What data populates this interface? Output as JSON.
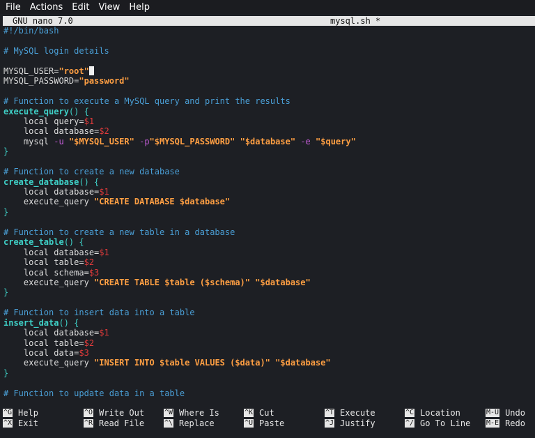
{
  "menubar": {
    "items": [
      "File",
      "Actions",
      "Edit",
      "View",
      "Help"
    ]
  },
  "titlebar": {
    "app_name": "GNU nano 7.0",
    "file_name": "mysql.sh *"
  },
  "editor": {
    "lines": [
      [
        {
          "t": "#!/bin/bash",
          "c": "comment"
        }
      ],
      [],
      [
        {
          "t": "# MySQL login details",
          "c": "comment"
        }
      ],
      [],
      [
        {
          "t": "MYSQL_USER=",
          "c": "text"
        },
        {
          "t": "\"root\"",
          "c": "string"
        },
        {
          "t": "",
          "c": "cursor"
        }
      ],
      [
        {
          "t": "MYSQL_PASSWORD=",
          "c": "text"
        },
        {
          "t": "\"password\"",
          "c": "string"
        }
      ],
      [],
      [
        {
          "t": "# Function to execute a MySQL query and print the results",
          "c": "comment"
        }
      ],
      [
        {
          "t": "execute_query",
          "c": "func"
        },
        {
          "t": "() {",
          "c": "brace"
        }
      ],
      [
        {
          "t": "    local query=",
          "c": "keyword"
        },
        {
          "t": "$1",
          "c": "var"
        }
      ],
      [
        {
          "t": "    local database=",
          "c": "keyword"
        },
        {
          "t": "$2",
          "c": "var"
        }
      ],
      [
        {
          "t": "    mysql ",
          "c": "text"
        },
        {
          "t": "-u",
          "c": "flag"
        },
        {
          "t": " ",
          "c": "text"
        },
        {
          "t": "\"$MYSQL_USER\"",
          "c": "string"
        },
        {
          "t": " ",
          "c": "text"
        },
        {
          "t": "-p",
          "c": "flag"
        },
        {
          "t": "\"$MYSQL_PASSWORD\"",
          "c": "string"
        },
        {
          "t": " ",
          "c": "text"
        },
        {
          "t": "\"$database\"",
          "c": "string"
        },
        {
          "t": " ",
          "c": "text"
        },
        {
          "t": "-e",
          "c": "flag"
        },
        {
          "t": " ",
          "c": "text"
        },
        {
          "t": "\"$query\"",
          "c": "string"
        }
      ],
      [
        {
          "t": "}",
          "c": "brace"
        }
      ],
      [],
      [
        {
          "t": "# Function to create a new database",
          "c": "comment"
        }
      ],
      [
        {
          "t": "create_database",
          "c": "func"
        },
        {
          "t": "() {",
          "c": "brace"
        }
      ],
      [
        {
          "t": "    local database=",
          "c": "keyword"
        },
        {
          "t": "$1",
          "c": "var"
        }
      ],
      [
        {
          "t": "    execute_query ",
          "c": "text"
        },
        {
          "t": "\"CREATE DATABASE $database\"",
          "c": "string"
        }
      ],
      [
        {
          "t": "}",
          "c": "brace"
        }
      ],
      [],
      [
        {
          "t": "# Function to create a new table in a database",
          "c": "comment"
        }
      ],
      [
        {
          "t": "create_table",
          "c": "func"
        },
        {
          "t": "() {",
          "c": "brace"
        }
      ],
      [
        {
          "t": "    local database=",
          "c": "keyword"
        },
        {
          "t": "$1",
          "c": "var"
        }
      ],
      [
        {
          "t": "    local table=",
          "c": "keyword"
        },
        {
          "t": "$2",
          "c": "var"
        }
      ],
      [
        {
          "t": "    local schema=",
          "c": "keyword"
        },
        {
          "t": "$3",
          "c": "var"
        }
      ],
      [
        {
          "t": "    execute_query ",
          "c": "text"
        },
        {
          "t": "\"CREATE TABLE $table ($schema)\"",
          "c": "string"
        },
        {
          "t": " ",
          "c": "text"
        },
        {
          "t": "\"$database\"",
          "c": "string"
        }
      ],
      [
        {
          "t": "}",
          "c": "brace"
        }
      ],
      [],
      [
        {
          "t": "# Function to insert data into a table",
          "c": "comment"
        }
      ],
      [
        {
          "t": "insert_data",
          "c": "func"
        },
        {
          "t": "() {",
          "c": "brace"
        }
      ],
      [
        {
          "t": "    local database=",
          "c": "keyword"
        },
        {
          "t": "$1",
          "c": "var"
        }
      ],
      [
        {
          "t": "    local table=",
          "c": "keyword"
        },
        {
          "t": "$2",
          "c": "var"
        }
      ],
      [
        {
          "t": "    local data=",
          "c": "keyword"
        },
        {
          "t": "$3",
          "c": "var"
        }
      ],
      [
        {
          "t": "    execute_query ",
          "c": "text"
        },
        {
          "t": "\"INSERT INTO $table VALUES ($data)\"",
          "c": "string"
        },
        {
          "t": " ",
          "c": "text"
        },
        {
          "t": "\"$database\"",
          "c": "string"
        }
      ],
      [
        {
          "t": "}",
          "c": "brace"
        }
      ],
      [],
      [
        {
          "t": "# Function to update data in a table",
          "c": "comment"
        }
      ]
    ]
  },
  "shortcuts": [
    {
      "key": "^G",
      "label": "Help"
    },
    {
      "key": "^X",
      "label": "Exit"
    },
    {
      "key": "^O",
      "label": "Write Out"
    },
    {
      "key": "^R",
      "label": "Read File"
    },
    {
      "key": "^W",
      "label": "Where Is"
    },
    {
      "key": "^\\",
      "label": "Replace"
    },
    {
      "key": "^K",
      "label": "Cut"
    },
    {
      "key": "^U",
      "label": "Paste"
    },
    {
      "key": "^T",
      "label": "Execute"
    },
    {
      "key": "^J",
      "label": "Justify"
    },
    {
      "key": "^C",
      "label": "Location"
    },
    {
      "key": "^/",
      "label": "Go To Line"
    },
    {
      "key": "M-U",
      "label": "Undo"
    },
    {
      "key": "M-E",
      "label": "Redo"
    }
  ],
  "colors": {
    "background": "#1d1f24",
    "comment": "#4a9fd6",
    "function": "#3fd0c7",
    "string": "#ff9f43",
    "variable": "#e23b3b",
    "flag": "#c25cd6",
    "bar": "#e6e6e6"
  }
}
